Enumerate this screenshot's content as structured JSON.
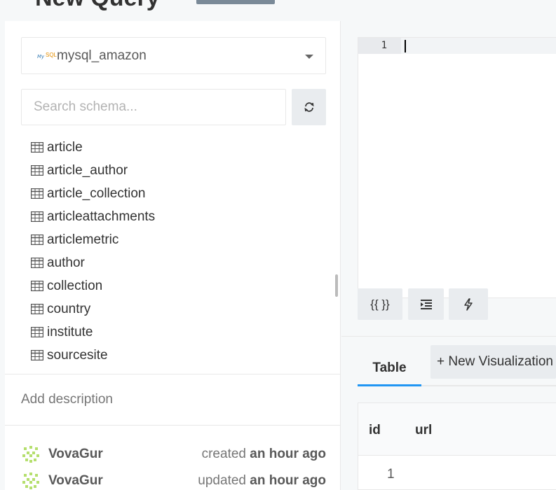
{
  "header": {
    "title": "New Query"
  },
  "datasource": {
    "name": "mysql_amazon",
    "logo_text_1": "My",
    "logo_text_2": "SQL"
  },
  "schema_search": {
    "placeholder": "Search schema..."
  },
  "schema": {
    "tables": [
      "article",
      "article_author",
      "article_collection",
      "articleattachments",
      "articlemetric",
      "author",
      "collection",
      "country",
      "institute",
      "sourcesite"
    ]
  },
  "description": {
    "label": "Add description"
  },
  "activity": [
    {
      "user": "VovaGur",
      "action": "created",
      "time": "an hour ago"
    },
    {
      "user": "VovaGur",
      "action": "updated",
      "time": "an hour ago"
    }
  ],
  "editor": {
    "line_number": "1",
    "buttons": {
      "format": "{{ }}"
    }
  },
  "tabs": {
    "table": "Table",
    "new_visualization": "+ New Visualization"
  },
  "results": {
    "columns": [
      "id",
      "url"
    ],
    "rows": [
      [
        "1",
        ""
      ]
    ]
  },
  "colors": {
    "accent": "#2196f3",
    "button_bg": "#e9ecef",
    "page_bg": "#f6f8f9"
  }
}
